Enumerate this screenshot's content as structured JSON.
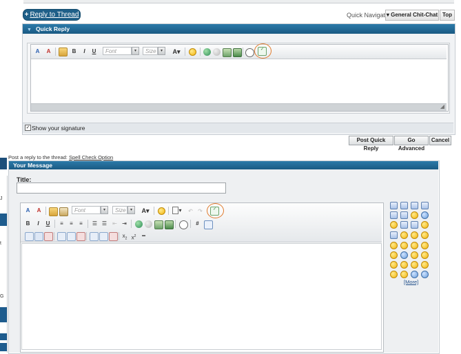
{
  "top": {
    "reply_button": {
      "plus": "+",
      "label": "Reply to Thread"
    },
    "quick_navigation": {
      "label": "Quick Navigation",
      "selected": "General Chit-Chat",
      "top_label": "Top"
    }
  },
  "quick_reply": {
    "title": "Quick Reply",
    "toolbar": {
      "font_placeholder": "Font",
      "size_placeholder": "Size",
      "bold": "B",
      "italic": "I",
      "underline": "U",
      "text_color": "A"
    },
    "show_signature": {
      "checked": true,
      "label": "Show your signature"
    },
    "buttons": {
      "post": "Post Quick Reply",
      "advanced": "Go Advanced",
      "cancel": "Cancel"
    }
  },
  "full_editor": {
    "prefix_text": "Post a reply to the thread:",
    "prefix_link": "Spell Check Option",
    "header": "Your Message",
    "title_label": "Title:",
    "title_value": "",
    "toolbar": {
      "font_placeholder": "Font",
      "size_placeholder": "Size",
      "bold": "B",
      "italic": "I",
      "underline": "U",
      "text_color": "A",
      "hash": "#",
      "subscript": "x",
      "superscript": "x"
    },
    "smilies_more": "[More]"
  },
  "left_rail": {
    "char_1": "J",
    "char_2": "t",
    "char_3": "G"
  }
}
